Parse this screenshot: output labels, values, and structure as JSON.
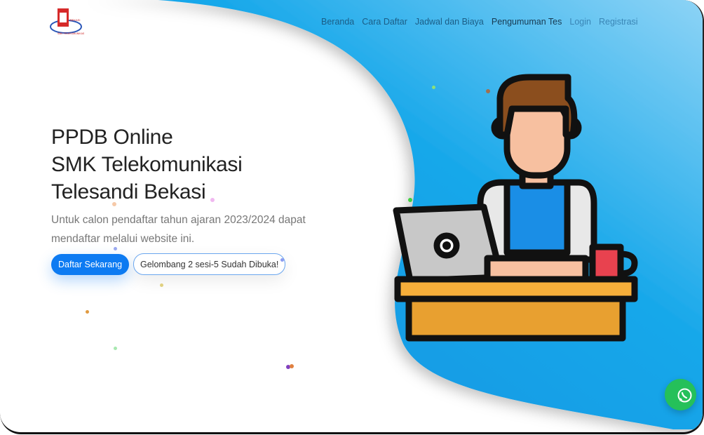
{
  "logo": {
    "text_top": "SEKOLAH BEKASI",
    "text_bottom": "SMK TELEKOMUNIKASI"
  },
  "nav": {
    "items": [
      "Beranda",
      "Cara Daftar",
      "Jadwal dan Biaya",
      "Pengumuman Tes",
      "Login",
      "Registrasi"
    ]
  },
  "hero": {
    "title_lines": [
      "PPDB Online",
      "SMK Telekomunikasi",
      "Telesandi Bekasi"
    ],
    "lead": "Untuk calon pendaftar tahun ajaran 2023/2024 dapat mendaftar melalui website ini.",
    "primary_button": "Daftar Sekarang",
    "secondary_button": "Gelombang 2 sesi-5 Sudah Dibuka!"
  },
  "whatsapp": {
    "icon": "whatsapp-icon"
  },
  "colors": {
    "blue": "#0aa0e6",
    "primary": "#0d7bf2",
    "whatsapp": "#25c05a"
  }
}
